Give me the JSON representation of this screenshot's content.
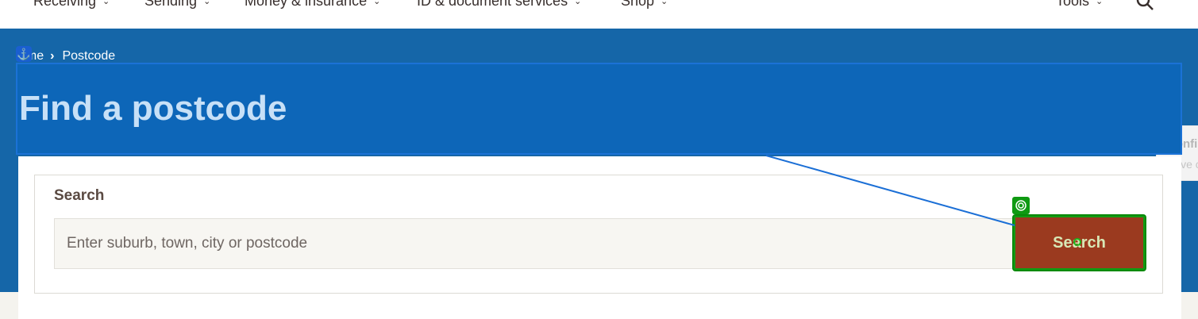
{
  "nav": {
    "items": [
      {
        "label": "Receiving"
      },
      {
        "label": "Sending"
      },
      {
        "label": "Money & insurance"
      },
      {
        "label": "ID & document services"
      },
      {
        "label": "Shop"
      },
      {
        "label": "Tools"
      }
    ],
    "chevron": "⌄"
  },
  "breadcrumb": {
    "home": "ome",
    "separator": "›",
    "current": "Postcode"
  },
  "page": {
    "title": "Find a postcode"
  },
  "search": {
    "label": "Search",
    "placeholder": "Enter suburb, town, city or postcode",
    "value": "",
    "button_label": "Search"
  },
  "toast": {
    "title": "Confi",
    "subtitle": "Save c"
  },
  "colors": {
    "hero_bg": "#1566a8",
    "title_band": "#0d66b8",
    "button_bg": "#9b3a1f",
    "highlight_green": "#129b12",
    "annotation_blue": "#1a5fd0"
  },
  "icons": {
    "anchor": "anchor-icon",
    "search": "search-icon",
    "target": "target-icon"
  }
}
